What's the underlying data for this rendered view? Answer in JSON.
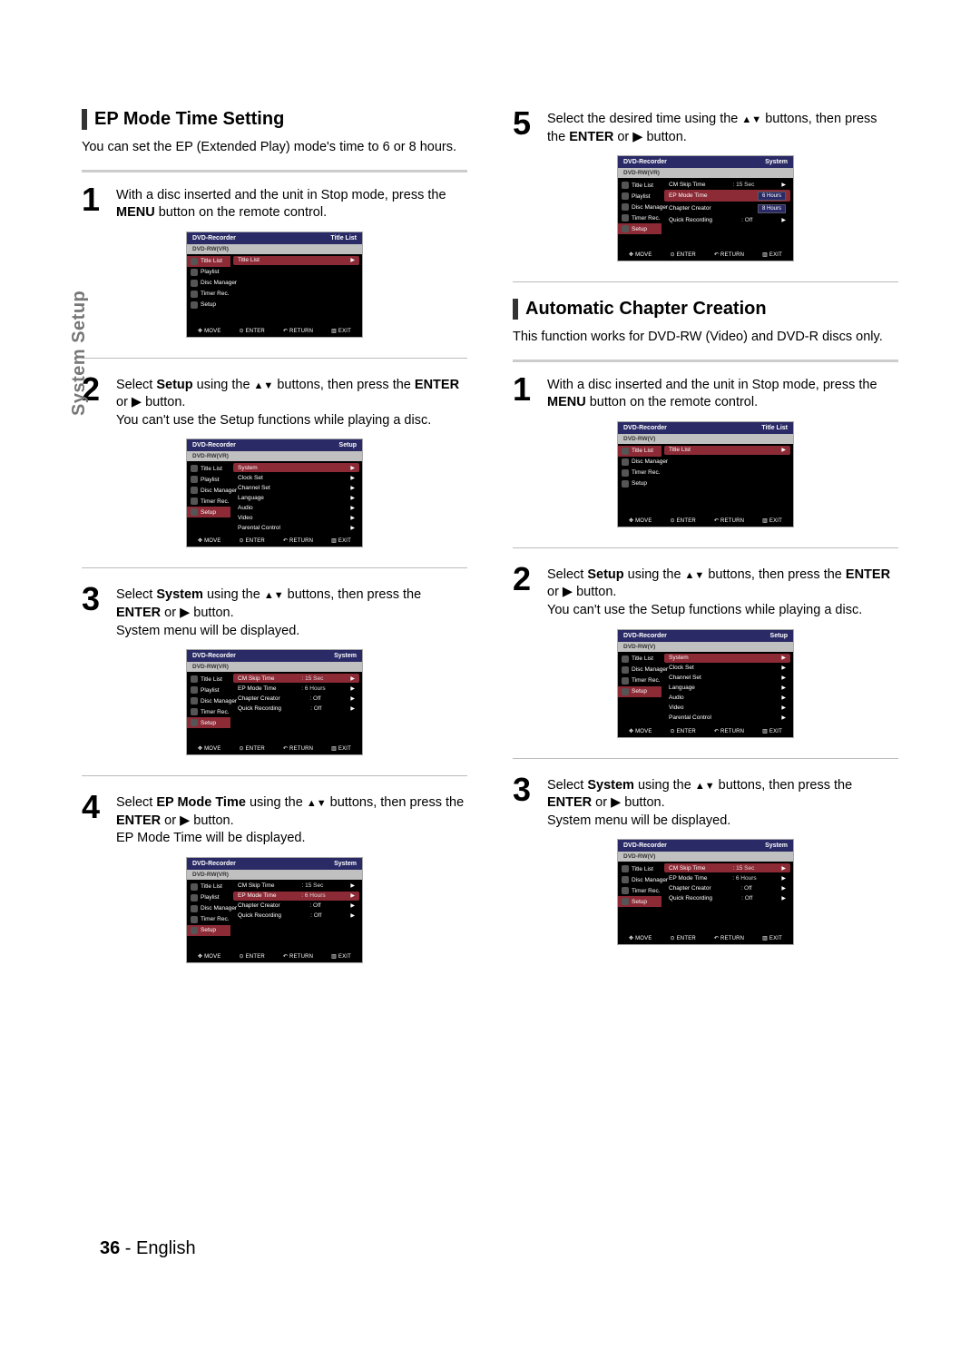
{
  "tab_label": "System Setup",
  "page_footer": {
    "num": "36",
    "sep": " - ",
    "lang": "English"
  },
  "left": {
    "h1": "EP Mode Time Setting",
    "intro": "You can set the EP (Extended Play) mode's time to 6 or 8 hours.",
    "step1": {
      "num": "1",
      "text_a": "With a disc inserted and the unit in Stop mode, press the ",
      "bold": "MENU",
      "text_b": " button on the remote control."
    },
    "step2": {
      "num": "2",
      "t1": "Select ",
      "b1": "Setup",
      "t2": " using the ",
      "b2": "▲▼",
      "t3": " buttons, then press the ",
      "b3": "ENTER",
      "t4": " or ",
      "b4": "▶",
      "t5": " button.",
      "note": "You can't use the Setup functions while playing a disc."
    },
    "step3": {
      "num": "3",
      "t1": "Select ",
      "b1": "System",
      "t2": " using the ",
      "b2": "▲▼",
      "t3": " buttons, then press the ",
      "b3": "ENTER",
      "t4": " or ",
      "b4": "▶",
      "t5": " button.",
      "note": "System menu will be displayed."
    },
    "step4": {
      "num": "4",
      "t1": "Select ",
      "b1": "EP Mode Time",
      "t2": " using the ",
      "b2": "▲▼",
      "t3": " buttons, then press the ",
      "b3": "ENTER",
      "t4": " or ",
      "b4": "▶",
      "t5": " button.",
      "note": "EP Mode Time will be displayed."
    }
  },
  "right": {
    "step5": {
      "num": "5",
      "t1": "Select the desired time using the ",
      "b1": "▲▼",
      "t2": " buttons, then press the ",
      "b2": "ENTER",
      "t3": " or ",
      "b3": "▶",
      "t4": " button."
    },
    "h2": "Automatic Chapter Creation",
    "intro2": "This function works for DVD-RW (Video) and DVD-R discs only.",
    "step1": {
      "num": "1",
      "text_a": "With a disc inserted and the unit in Stop mode, press the ",
      "bold": "MENU",
      "text_b": " button on the remote control."
    },
    "step2": {
      "num": "2",
      "t1": "Select ",
      "b1": "Setup",
      "t2": " using the ",
      "b2": "▲▼",
      "t3": " buttons, then press the ",
      "b3": "ENTER",
      "t4": " or ",
      "b4": "▶",
      "t5": " button.",
      "note": "You can't use the Setup functions while playing a disc."
    },
    "step3": {
      "num": "3",
      "t1": "Select ",
      "b1": "System",
      "t2": " using the ",
      "b2": "▲▼",
      "t3": " buttons, then press the ",
      "b3": "ENTER",
      "t4": " or ",
      "b4": "▶",
      "t5": " button.",
      "note": "System menu will be displayed."
    }
  },
  "osd": {
    "header_title": "DVD-Recorder",
    "title_titlelist": "Title List",
    "title_setup": "Setup",
    "title_system": "System",
    "disc_vr": "DVD-RW(VR)",
    "disc_v": "DVD-RW(V)",
    "side_full": [
      "Title List",
      "Playlist",
      "Disc Manager",
      "Timer Rec.",
      "Setup"
    ],
    "side_v": [
      "Title List",
      "Disc Manager",
      "Timer Rec.",
      "Setup"
    ],
    "main_titlelist": "Title List",
    "setup_rows": [
      "System",
      "Clock Set",
      "Channel Set",
      "Language",
      "Audio",
      "Video",
      "Parental Control"
    ],
    "sys_rows": [
      {
        "k": "CM Skip Time",
        "v": ": 15 Sec"
      },
      {
        "k": "EP Mode Time",
        "v": ": 6 Hours"
      },
      {
        "k": "Chapter Creator",
        "v": ": Off"
      },
      {
        "k": "Quick Recording",
        "v": ": Off"
      }
    ],
    "ep_opts": [
      "6 Hours",
      "8 Hours"
    ],
    "footer": {
      "move": "MOVE",
      "enter": "ENTER",
      "return": "RETURN",
      "exit": "EXIT"
    }
  }
}
